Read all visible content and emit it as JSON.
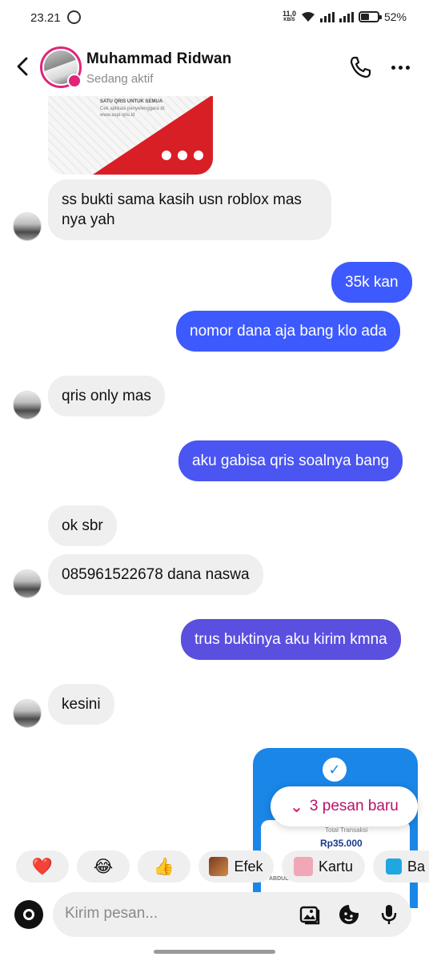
{
  "status_bar": {
    "time": "23.21",
    "speed_top": "11,0",
    "speed_unit": "KB/S",
    "battery": "52%",
    "battery_level": 0.52
  },
  "header": {
    "name": "Muhammad Ridwan",
    "status": "Sedang aktif"
  },
  "qris_card": {
    "lines": [
      "SATU QRIS UNTUK SEMUA",
      "Cek aplikasi penyelenggara di:",
      "www.aspi-qris.id"
    ]
  },
  "messages": [
    {
      "side": "in",
      "text": "ss bukti sama kasih usn roblox mas nya yah"
    },
    {
      "side": "out",
      "text": "35k kan"
    },
    {
      "side": "out",
      "text": "nomor dana aja bang klo ada"
    },
    {
      "side": "in",
      "text": "qris only mas"
    },
    {
      "side": "out",
      "text": "aku gabisa qris soalnya bang"
    },
    {
      "side": "in",
      "text": "ok sbr"
    },
    {
      "side": "in",
      "text": "085961522678 dana naswa"
    },
    {
      "side": "out",
      "text": "trus buktinya aku kirim kmna"
    },
    {
      "side": "in",
      "text": "kesini"
    }
  ],
  "receipt": {
    "label": "Total Transaksi",
    "amount": "Rp35.000",
    "sender": "ABDUL HAKIM HASAL"
  },
  "new_messages": {
    "icon": "double-chevron-down-icon",
    "label": "3 pesan baru"
  },
  "quick_replies": [
    {
      "emoji": "❤️",
      "icon": "heart-emoji"
    },
    {
      "emoji": "😂",
      "icon": "laughing-emoji"
    },
    {
      "emoji": "👍",
      "icon": "thumbs-up-emoji"
    },
    {
      "label": "Efek"
    },
    {
      "label": "Kartu"
    },
    {
      "label": "Ba"
    }
  ],
  "composer": {
    "placeholder": "Kirim pesan..."
  },
  "colors": {
    "accent_pink": "#e0247a",
    "bubble_blue": "#3d5afe",
    "bubble_purple": "#5b4fe0",
    "incoming_bg": "#efefef"
  }
}
